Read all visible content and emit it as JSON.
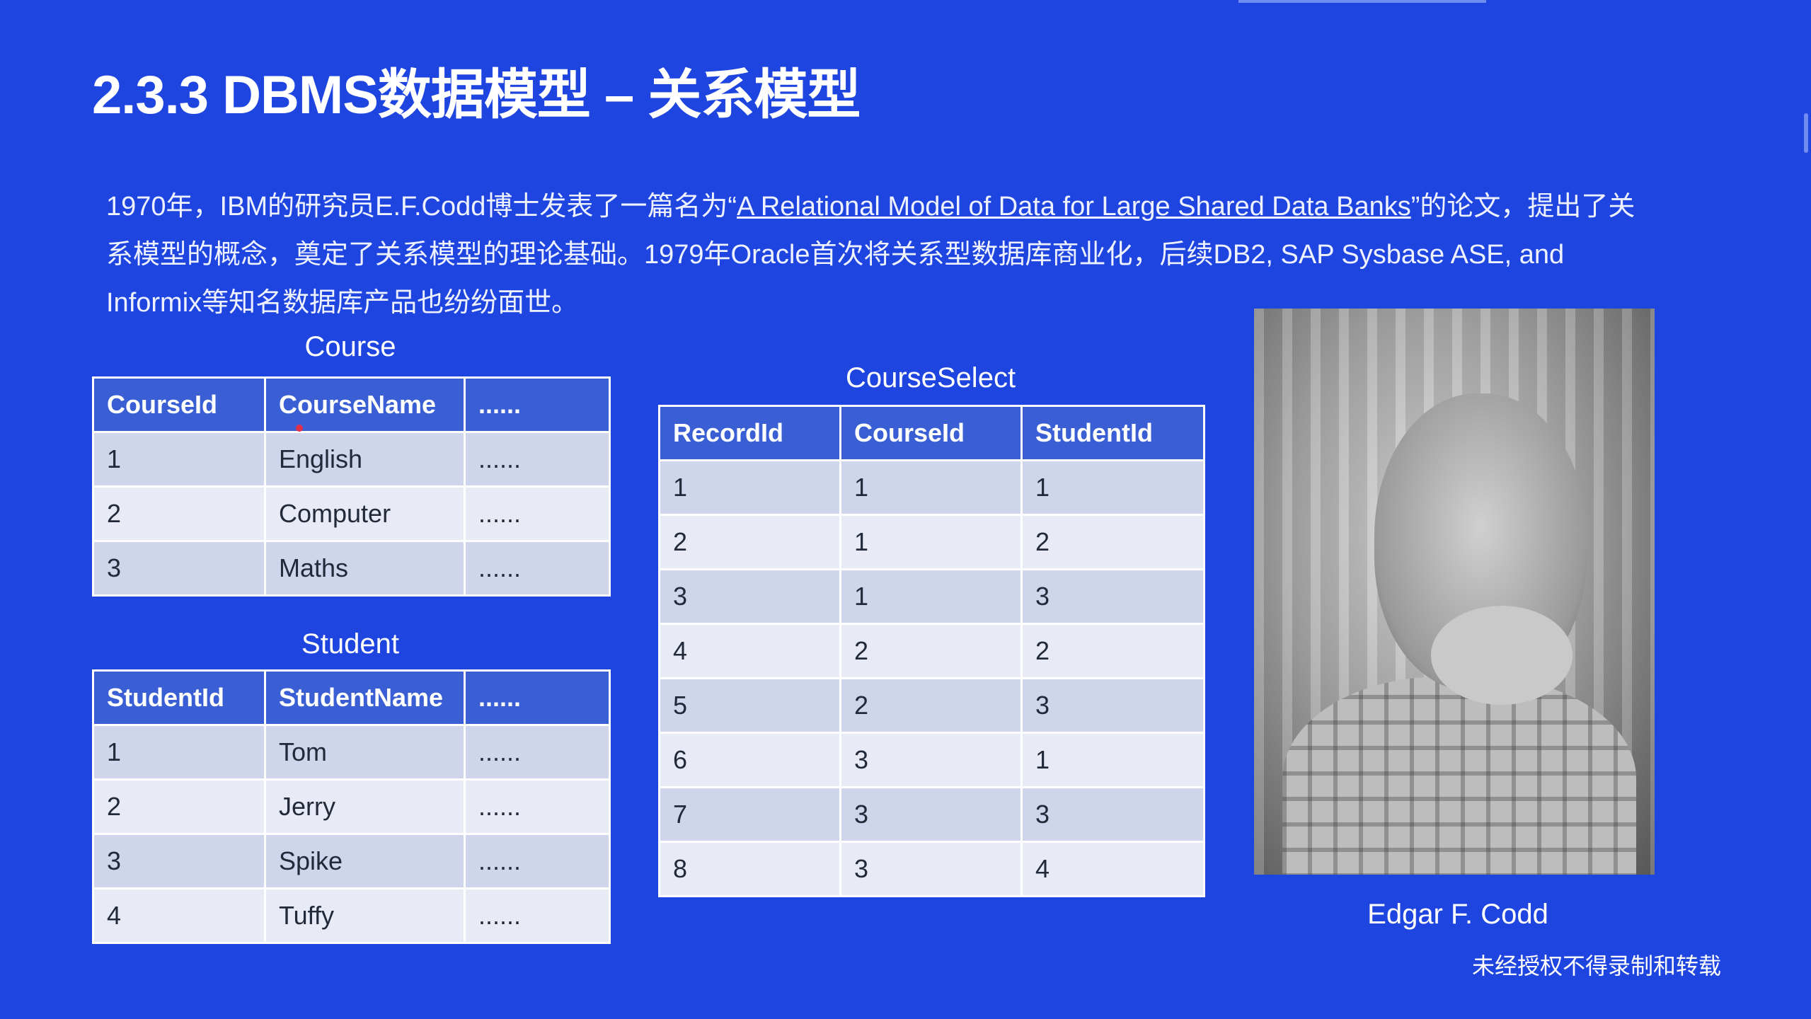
{
  "slide": {
    "title": "2.3.3 DBMS数据模型 – 关系模型",
    "intro_part1": "1970年，IBM的研究员E.F.Codd博士发表了一篇名为“",
    "intro_link": "A Relational Model of Data for Large Shared Data Banks",
    "intro_part2": "”的论文，提出了关系模型的概念，奠定了关系模型的理论基础。1979年Oracle首次将关系型数据库商业化，后续DB2, SAP Sysbase ASE, and Informix等知名数据库产品也纷纷面世。",
    "watermark": "未经授权不得录制和转载"
  },
  "course_table": {
    "caption": "Course",
    "headers": [
      "CourseId",
      "CourseName",
      "......"
    ],
    "rows": [
      [
        "1",
        "English",
        "......"
      ],
      [
        "2",
        "Computer",
        "......"
      ],
      [
        "3",
        "Maths",
        "......"
      ]
    ]
  },
  "student_table": {
    "caption": "Student",
    "headers": [
      "StudentId",
      "StudentName",
      "......"
    ],
    "rows": [
      [
        "1",
        "Tom",
        "......"
      ],
      [
        "2",
        "Jerry",
        "......"
      ],
      [
        "3",
        "Spike",
        "......"
      ],
      [
        "4",
        "Tuffy",
        "......"
      ]
    ]
  },
  "courseselect_table": {
    "caption": "CourseSelect",
    "headers": [
      "RecordId",
      "CourseId",
      "StudentId"
    ],
    "rows": [
      [
        "1",
        "1",
        "1"
      ],
      [
        "2",
        "1",
        "2"
      ],
      [
        "3",
        "1",
        "3"
      ],
      [
        "4",
        "2",
        "2"
      ],
      [
        "5",
        "2",
        "3"
      ],
      [
        "6",
        "3",
        "1"
      ],
      [
        "7",
        "3",
        "3"
      ],
      [
        "8",
        "3",
        "4"
      ]
    ]
  },
  "portrait": {
    "caption": "Edgar F. Codd"
  },
  "colors": {
    "background": "#1f45e0",
    "table_header": "#3a5fd4",
    "row_dark": "#cfd5ea",
    "row_light": "#e8ebf5"
  }
}
